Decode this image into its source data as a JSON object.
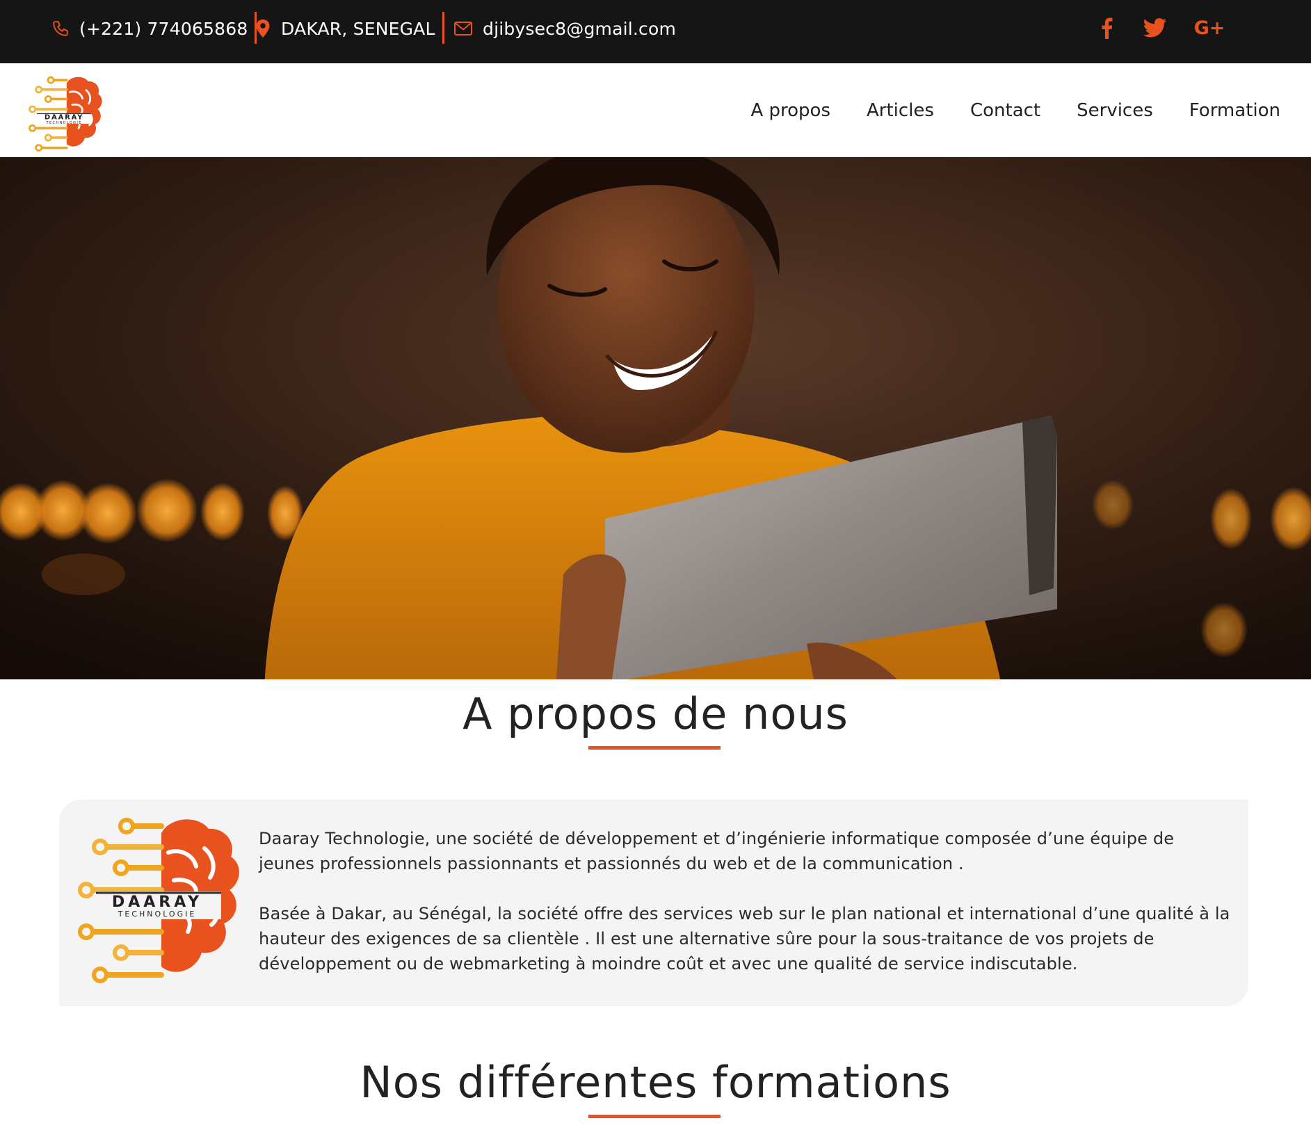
{
  "topbar": {
    "phone": "(+221) 774065868",
    "location": "DAKAR, SENEGAL",
    "email": "djibysec8@gmail.com",
    "phone_icon": "phone-icon",
    "location_icon": "map-pin-icon",
    "email_icon": "envelope-icon",
    "social": [
      "facebook-icon",
      "twitter-icon",
      "google-plus-icon"
    ],
    "google_plus_label": "G+"
  },
  "brand": {
    "logo_line1": "DAARAY",
    "logo_line2": "TECHNOLOGIE"
  },
  "nav": {
    "items": [
      "A propos",
      "Articles",
      "Contact",
      "Services",
      "Formation"
    ]
  },
  "about": {
    "title": "A propos de nous",
    "paragraph1": "Daaray Technologie, une société de développement et d’ingénierie informatique composée d’une équipe de jeunes professionnels passionnants et passionnés du web et de la communication .",
    "paragraph2": "Basée à Dakar, au Sénégal, la société offre des services web sur le plan national et international d’une qualité à la hauteur des exigences de sa clientèle . Il est une alternative sûre pour la sous-traitance de vos projets de développement ou de webmarketing à moindre coût et avec une qualité de service indiscutable."
  },
  "formations": {
    "title": "Nos différentes formations"
  },
  "colors": {
    "accent": "#e8521f",
    "topbar_bg": "#151515",
    "card_bg": "#f4f4f4",
    "logo_gold": "#f0a41f"
  }
}
